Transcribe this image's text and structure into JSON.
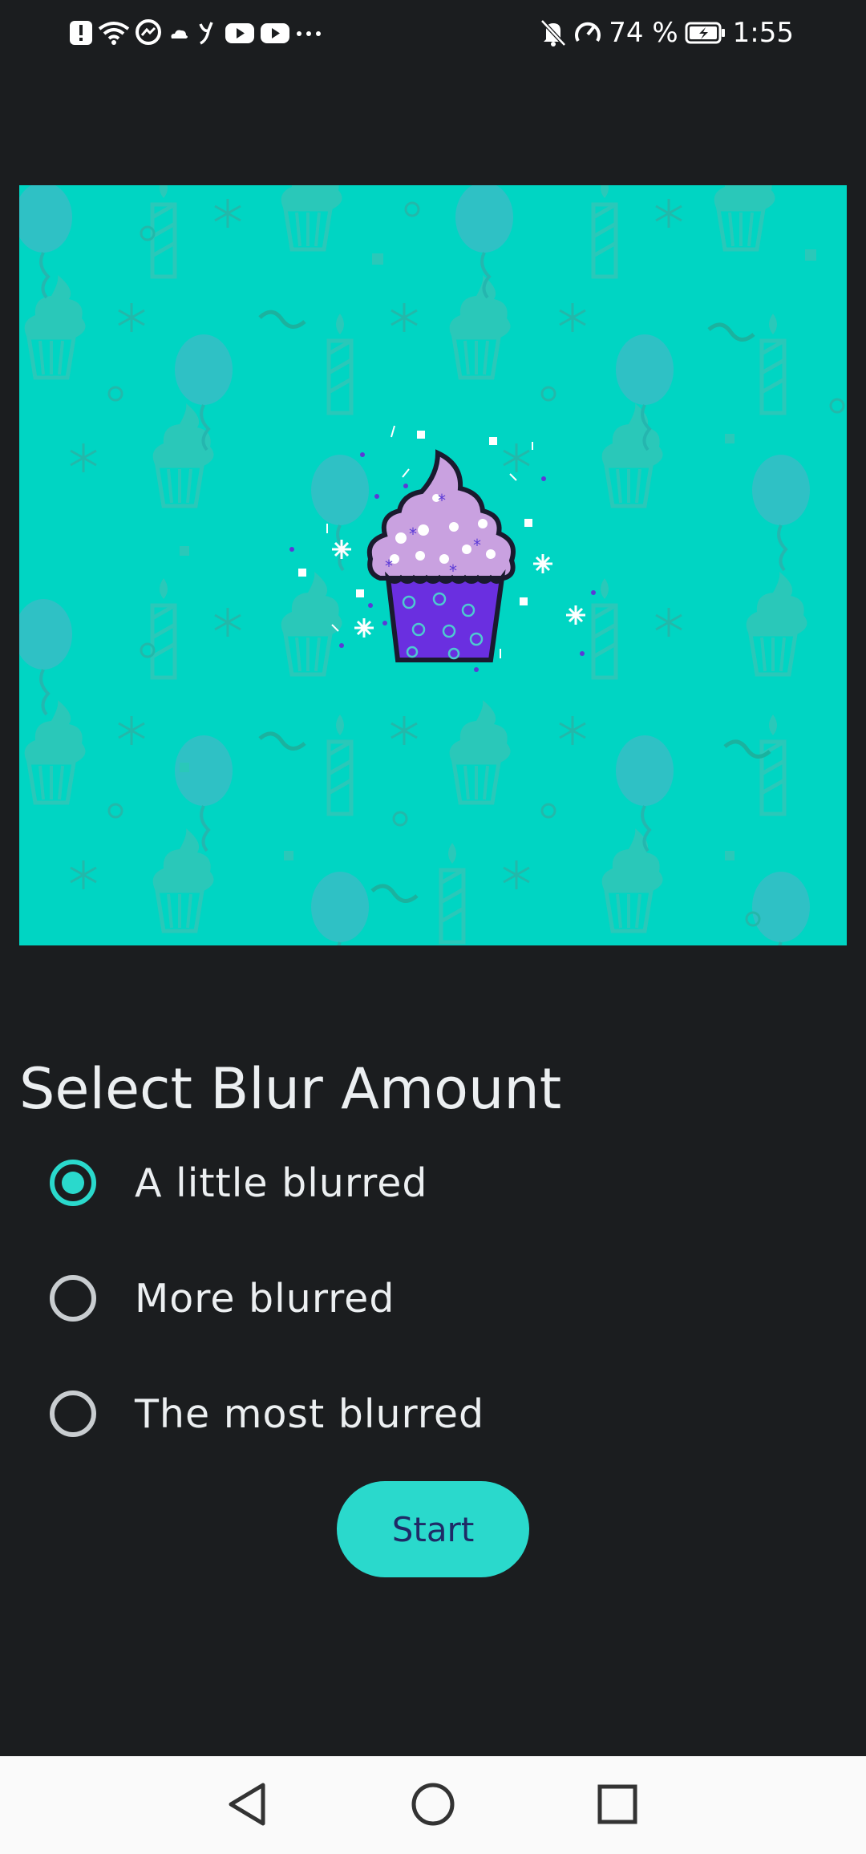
{
  "status_bar": {
    "battery_percent": "74 %",
    "time": "1:55",
    "left_icons": [
      "alert-icon",
      "wifi-icon",
      "messenger-icon",
      "cloud-icon",
      "app-y-icon",
      "youtube-icon",
      "youtube-icon",
      "more-dots-icon"
    ],
    "right_icons": [
      "bell-off-icon",
      "data-saver-icon",
      "battery-charging-icon"
    ]
  },
  "hero": {
    "description_icon": "cupcake-illustration",
    "background_color": "#00d5c3"
  },
  "blur_selection": {
    "title": "Select Blur Amount",
    "options": [
      {
        "label": "A little blurred",
        "checked": true
      },
      {
        "label": "More blurred",
        "checked": false
      },
      {
        "label": "The most blurred",
        "checked": false
      }
    ]
  },
  "start_button": {
    "label": "Start"
  },
  "nav_bar": {
    "back": "back-icon",
    "home": "home-icon",
    "recents": "recents-icon"
  },
  "colors": {
    "accent": "#2ad9cc",
    "background": "#1b1d1f",
    "button_text": "#1f2a66"
  }
}
